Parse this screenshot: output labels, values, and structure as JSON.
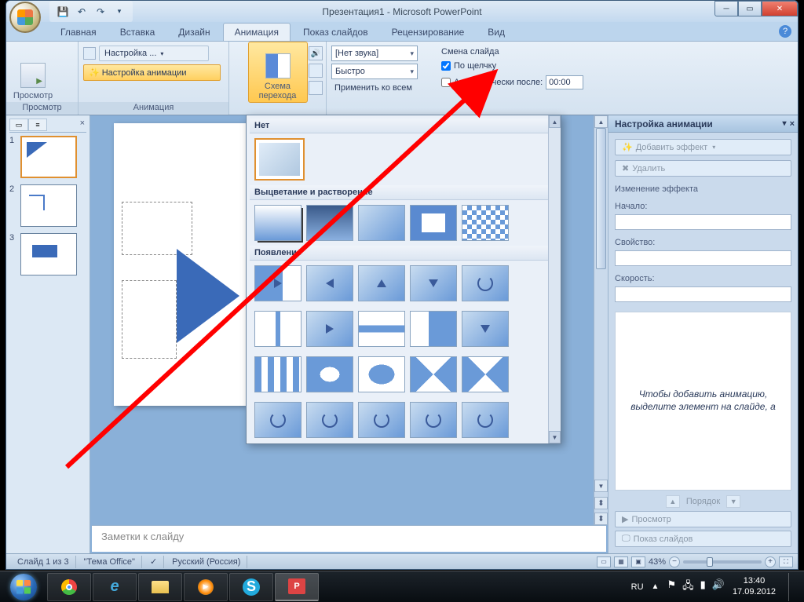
{
  "title": "Презентация1 - Microsoft PowerPoint",
  "tabs": {
    "home": "Главная",
    "insert": "Вставка",
    "design": "Дизайн",
    "animation": "Анимация",
    "slideshow": "Показ слайдов",
    "review": "Рецензирование",
    "view": "Вид"
  },
  "ribbon": {
    "preview_label": "Просмотр",
    "preview_group": "Просмотр",
    "custom_btn": "Настройка ...",
    "custom_anim_btn": "Настройка анимации",
    "animation_group": "Анимация",
    "scheme_btn": "Схема\nперехода",
    "sound_field": "[Нет звука]",
    "speed_field": "Быстро",
    "apply_all": "Применить ко всем",
    "advance_header": "Смена слайда",
    "on_click": "По щелчку",
    "auto_after": "Автоматически после:",
    "time_value": "00:00"
  },
  "gallery": {
    "none": "Нет",
    "fade": "Выцветание и растворение",
    "appear": "Появление"
  },
  "slides": {
    "nums": [
      "1",
      "2",
      "3"
    ]
  },
  "notes_placeholder": "Заметки к слайду",
  "anim_pane": {
    "title": "Настройка анимации",
    "add_effect": "Добавить эффект",
    "delete": "Удалить",
    "change_label": "Изменение эффекта",
    "start_label": "Начало:",
    "property_label": "Свойство:",
    "speed_label": "Скорость:",
    "hint": "Чтобы добавить анимацию, выделите элемент на слайде, а",
    "order": "Порядок",
    "preview": "Просмотр",
    "slideshow": "Показ слайдов"
  },
  "status": {
    "slide_info": "Слайд 1 из 3",
    "theme": "\"Тема Office\"",
    "lang": "Русский (Россия)",
    "zoom": "43%"
  },
  "tray": {
    "lang": "RU",
    "time": "13:40",
    "date": "17.09.2012"
  }
}
